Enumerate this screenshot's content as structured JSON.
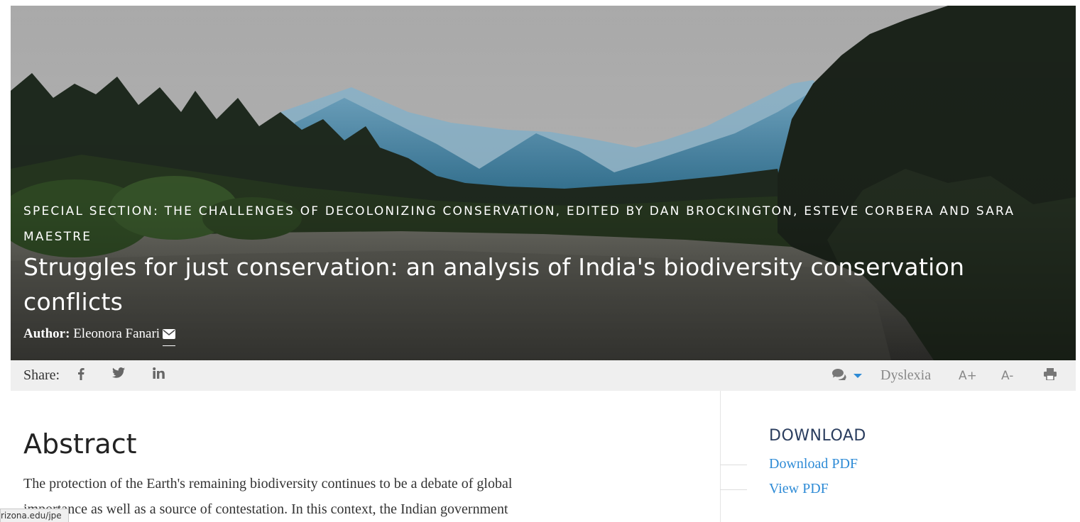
{
  "hero": {
    "section_label": "SPECIAL SECTION: THE CHALLENGES OF DECOLONIZING CONSERVATION, EDITED BY DAN BROCKINGTON, ESTEVE CORBERA AND SARA MAESTRE",
    "title": "Struggles for just conservation: an analysis of India's biodiversity conservation conflicts",
    "author_label": "Author:",
    "author_name": "Eleonora Fanari",
    "background": "mountain-river-forest-photo"
  },
  "share_bar": {
    "label": "Share:",
    "icons": [
      "facebook-icon",
      "twitter-icon",
      "linkedin-icon"
    ],
    "tools": {
      "comments_icon": "comments-icon",
      "dropdown_icon": "caret-down-icon",
      "dyslexia": "Dyslexia",
      "increase_font": "A+",
      "decrease_font": "A-",
      "print_icon": "print-icon"
    }
  },
  "main": {
    "abstract_heading": "Abstract",
    "abstract_text": "The protection of the Earth's remaining biodiversity continues to be a debate of global importance as well as a source of contestation. In this context, the Indian government"
  },
  "sidebar": {
    "title": "DOWNLOAD",
    "links": [
      "Download PDF",
      "View PDF"
    ]
  },
  "status_bar": {
    "url": "rizona.edu/jpe"
  },
  "colors": {
    "link": "#2e8bd6",
    "sidebar_title": "#2a3d5e",
    "share_bar_bg": "#efefef",
    "caret": "#2e8bd6"
  }
}
